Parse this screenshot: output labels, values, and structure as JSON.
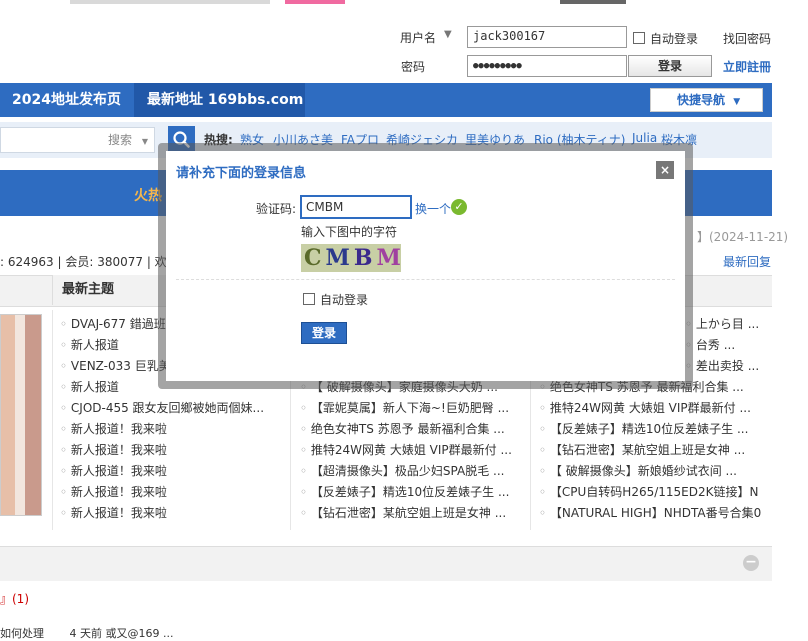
{
  "login": {
    "username_label": "用户名",
    "username_value": "jack300167",
    "auto_login": "自动登录",
    "find_password": "找回密码",
    "password_label": "密码",
    "password_mask": "●●●●●●●●●",
    "login_button": "登录",
    "register": "立即註冊"
  },
  "nav": {
    "item1": "2024地址发布页",
    "item2": "最新地址 169bbs.com",
    "quick_nav": "快捷导航"
  },
  "search": {
    "type": "搜索",
    "hot_label": "热搜:",
    "hotwords": [
      "熟女",
      "小川あさ美",
      "FAプロ",
      "希崎ジェシカ",
      "里美ゆりあ",
      "Rio (柚木ティナ)",
      "Julia",
      "桜木凛"
    ]
  },
  "banner": {
    "text": "火热"
  },
  "stats": {
    "text": ": 624963 | 会员: 380077 | 欢",
    "date_partial": "】(2024-11-21)",
    "latest_reply": "最新回复"
  },
  "tabs": {
    "latest_topics": "最新主题"
  },
  "lists": {
    "col1": [
      "DVAJ-677 錯過班",
      "新人报道",
      "VENZ-033 巨乳美",
      "新人报道",
      "CJOD-455 跟女友回鄉被她両個妹...",
      "新人报道！我来啦",
      "新人报道！我来啦",
      "新人报道！我来啦",
      "新人报道！我来啦",
      "新人报道！我来啦"
    ],
    "col2": [
      "【 破解摄像头】家庭摄像头大奶 ...",
      "【霏妮莫属】新人下海~!巨奶肥臀 ...",
      "绝色女神TS 苏恩予 最新福利合集 ...",
      "推特24W网黄 大婊姐 VIP群最新付 ...",
      "【超清摄像头】极品少妇SPA脱毛 ...",
      "【反差婊子】精选10位反差婊子生 ...",
      "【钻石泄密】某航空姐上班是女神 ..."
    ],
    "col3_top": [
      "上から目 ...",
      "台秀 ...",
      "差出卖投 ..."
    ],
    "col3": [
      "绝色女神TS 苏恩予 最新福利合集 ...",
      "推特24W网黄 大婊姐 VIP群最新付 ...",
      "【反差婊子】精选10位反差婊子生 ...",
      "【钻石泄密】某航空姐上班是女神 ...",
      "【 破解摄像头】新娘婚纱试衣间 ...",
      "【CPU自转码H265/115ED2K链接】N",
      "【NATURAL HIGH】NHDTA番号合集0"
    ]
  },
  "bottom": {
    "item": "』(1)",
    "line": "如何处理 　　4 天前 或又@169 ..."
  },
  "dialog": {
    "title": "请补充下面的登录信息",
    "close": "×",
    "captcha_label": "验证码:",
    "captcha_value": "CMBM",
    "refresh": "换一个",
    "hint": "输入下图中的字符",
    "captcha_image_text": "CMBM",
    "auto_login": "自动登录",
    "submit": "登录"
  },
  "colors": {
    "accent": "#2e6cc1",
    "banner_text": "#f5b64b"
  }
}
